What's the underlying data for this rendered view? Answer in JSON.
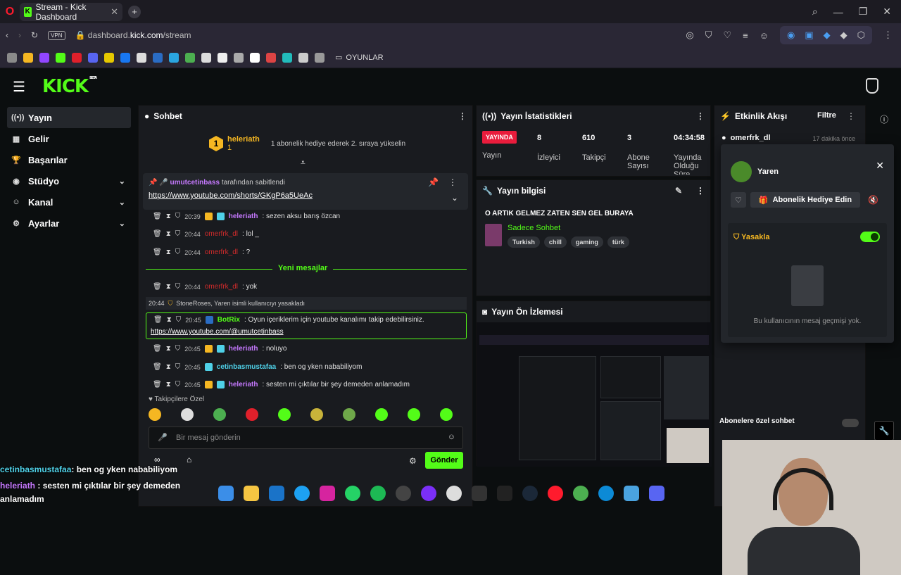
{
  "browser": {
    "tab_title": "Stream - Kick Dashboard",
    "url_domain": "dashboard.",
    "url_host": "kick.com",
    "url_path": "/stream",
    "vpn": "VPN",
    "bookmark_folder": "OYUNLAR"
  },
  "app": {
    "brand": "KICK",
    "beta": "BETA",
    "sidebar": [
      {
        "label": "Yayın",
        "icon": "broadcast-icon",
        "active": true
      },
      {
        "label": "Gelir",
        "icon": "revenue-icon"
      },
      {
        "label": "Başarılar",
        "icon": "trophy-icon"
      },
      {
        "label": "Stüdyo",
        "icon": "studio-icon",
        "expandable": true
      },
      {
        "label": "Kanal",
        "icon": "channel-icon",
        "expandable": true
      },
      {
        "label": "Ayarlar",
        "icon": "gear-icon",
        "expandable": true
      }
    ]
  },
  "chat": {
    "title": "Sohbet",
    "leader": {
      "rank": "1",
      "name": "heleriath",
      "count": "1",
      "message": "1 abonelik hediye ederek 2. sıraya yükselin"
    },
    "pinned": {
      "by": "umutcetinbass",
      "by_suffix": "tarafından sabitlendi",
      "link": "https://www.youtube.com/shorts/GKgP6a5UeAc"
    },
    "messages": [
      {
        "time": "20:39",
        "user": "heleriath",
        "text": ": sezen aksu barış özcan"
      },
      {
        "time": "20:44",
        "user": "omerfrk_dl",
        "text": ": lol _"
      },
      {
        "time": "20:44",
        "user": "omerfrk_dl",
        "text": ": ?"
      },
      {
        "time": "20:44",
        "user": "omerfrk_dl",
        "text": ": yok"
      }
    ],
    "new_messages": "Yeni mesajlar",
    "system": {
      "time": "20:44",
      "text": "StoneRoses, Yaren isimli kullanıcıyı yasakladı"
    },
    "bot": {
      "time": "20:45",
      "user": "BotRix",
      "text": ": Oyun içeriklerim için youtube kanalımı takip edebilirsiniz.",
      "link": "https://www.youtube.com/@umutcetinbass"
    },
    "messages2": [
      {
        "time": "20:45",
        "user": "heleriath",
        "text": ": noluyo",
        "color": "purple"
      },
      {
        "time": "20:45",
        "user": "cetinbasmustafaa",
        "text": ": ben og yken nababiliyom",
        "color": "cyan"
      },
      {
        "time": "20:45",
        "user": "heleriath",
        "text": ": sesten mi çıktılar bir şey demeden anlamadım",
        "color": "purple"
      }
    ],
    "followers_only": "Takipçilere Özel",
    "input_placeholder": "Bir mesaj gönderin",
    "send": "Gönder"
  },
  "stats": {
    "title": "Yayın İstatistikleri",
    "status": "YAYINDA",
    "status_label": "Yayın",
    "viewers": "8",
    "viewers_label": "İzleyici",
    "followers": "610",
    "followers_label": "Takipçi",
    "subs": "3",
    "subs_label": "Abone Sayısı",
    "uptime": "04:34:58",
    "uptime_label": "Yayında Olduğu Süre"
  },
  "info": {
    "title": "Yayın bilgisi",
    "stream_title": "O ARTIK GELMEZ ZATEN SEN GEL BURAYA",
    "category": "Sadece Sohbet",
    "tags": [
      "Turkish",
      "chill",
      "gaming",
      "türk"
    ]
  },
  "preview": {
    "title": "Yayın Ön İzlemesi"
  },
  "activity": {
    "title": "Etkinlik Akışı",
    "filter": "Filtre",
    "row_user": "omerfrk_dl",
    "row_time": "17 dakika önce",
    "popup": {
      "name": "Yaren",
      "gift": "Abonelik Hediye Edin",
      "ban": "Yasakla",
      "empty": "Bu kullanıcının mesaj geçmişi yok."
    },
    "subs_only": "Abonelere özel sohbet"
  },
  "overlay": {
    "line1_user": "cetinbasmustafaa",
    "line1_text": ": ben og yken nababiliyom",
    "line2_user": "heleriath",
    "line2_text": ": sesten mi çıktılar bir şey demeden",
    "line3_text": "anlamadım"
  }
}
